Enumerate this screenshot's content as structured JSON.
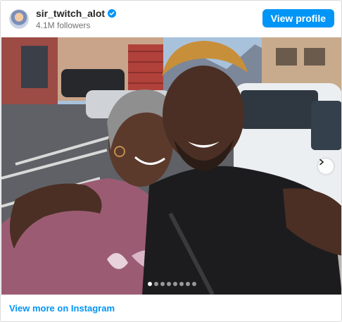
{
  "profile": {
    "username": "sir_twitch_alot",
    "followers": "4.1M followers",
    "view_profile_label": "View profile"
  },
  "carousel": {
    "slide_count": 8,
    "active_index": 0
  },
  "footer": {
    "link_label": "View more on Instagram"
  },
  "colors": {
    "accent": "#0095f6",
    "link": "#0095f6"
  },
  "icons": {
    "verified": "verified-badge-icon",
    "next": "chevron-right-icon"
  }
}
